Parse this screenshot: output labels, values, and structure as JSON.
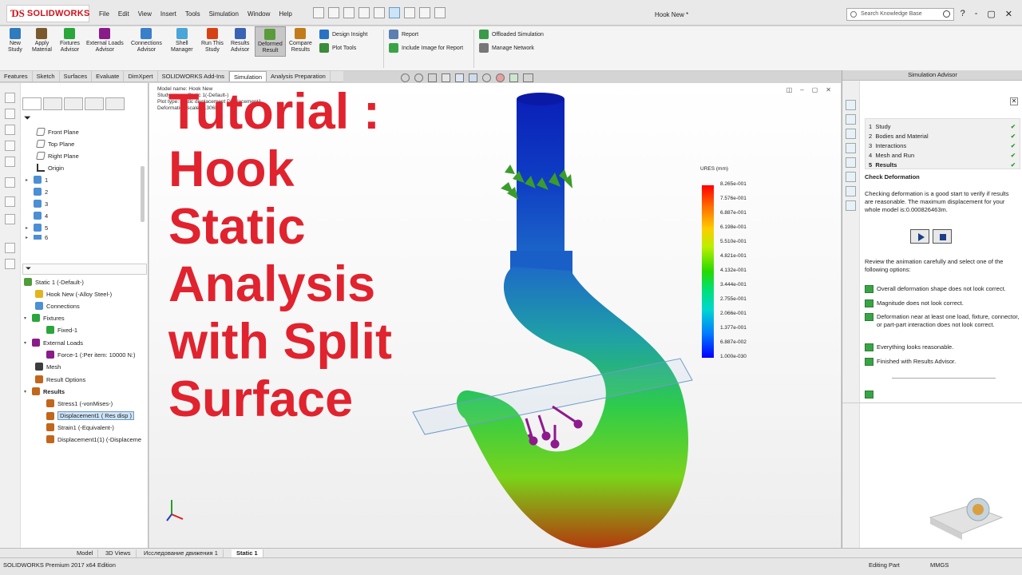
{
  "app": {
    "brand_ds": "ƊS",
    "brand_name": "SOLIDWORKS",
    "doc_title": "Hook New *",
    "search_placeholder": "Search Knowledge Base",
    "window_controls": [
      "?",
      "-",
      "▢",
      "✕"
    ]
  },
  "menu": [
    "File",
    "Edit",
    "View",
    "Insert",
    "Tools",
    "Simulation",
    "Window",
    "Help"
  ],
  "ribbon": {
    "buttons": [
      {
        "label1": "New",
        "label2": "Study",
        "color": "#2e7bbf"
      },
      {
        "label1": "Apply",
        "label2": "Material",
        "color": "#7a5a2c"
      },
      {
        "label1": "Fixtures",
        "label2": "Advisor",
        "color": "#2aa63b"
      },
      {
        "label1": "External Loads",
        "label2": "Advisor",
        "color": "#8a1c8a"
      },
      {
        "label1": "Connections",
        "label2": "Advisor",
        "color": "#3a7fc9"
      },
      {
        "label1": "Shell",
        "label2": "Manager",
        "color": "#4aa5d8"
      },
      {
        "label1": "Run This",
        "label2": "Study",
        "color": "#d64215"
      },
      {
        "label1": "Results",
        "label2": "Advisor",
        "color": "#3a63b5"
      },
      {
        "label1": "Deformed",
        "label2": "Result",
        "color": "#5a9c3a"
      },
      {
        "label1": "Compare",
        "label2": "Results",
        "color": "#c27b1b"
      }
    ],
    "small": [
      "Design Insight",
      "Plot Tools",
      "Report",
      "Include Image for Report",
      "Offloaded Simulation",
      "Manage Network"
    ]
  },
  "tabs": [
    "Features",
    "Sketch",
    "Surfaces",
    "Evaluate",
    "DimXpert",
    "SOLIDWORKS Add-Ins",
    "Simulation",
    "Analysis Preparation"
  ],
  "feature_tree": [
    "Front Plane",
    "Top Plane",
    "Right Plane",
    "Origin",
    "1",
    "2",
    "3",
    "4",
    "5",
    "6"
  ],
  "study_tree": {
    "study": "Static 1 (-Default-)",
    "part": "Hook New (-Alloy Steel-)",
    "connections": "Connections",
    "fixtures": "Fixtures",
    "fixed": "Fixed-1",
    "external_loads": "External Loads",
    "force": "Force-1 (:Per item: 10000 N:)",
    "mesh": "Mesh",
    "result_options": "Result Options",
    "results": "Results",
    "stress": "Stress1 (-vonMises-)",
    "displacement": "Displacement1 ( Res disp )",
    "strain": "Strain1 (-Equivalent-)",
    "displacement2": "Displacement1(1) (-Displaceme"
  },
  "viewport": {
    "info_lines": [
      "Model name: Hook New",
      "Study name: Static 1(-Default-)",
      "Plot type: Static displacement Displacement1",
      "Deformation scale: 8.3068"
    ],
    "overlay_lines": [
      "Tutorial :",
      "Hook",
      "Static",
      "Analysis",
      "with Split",
      "Surface"
    ],
    "legend_title": "URES (mm)",
    "legend_values": [
      "8.265e-001",
      "7.576e-001",
      "6.887e-001",
      "6.198e-001",
      "5.510e-001",
      "4.821e-001",
      "4.132e-001",
      "3.444e-001",
      "2.755e-001",
      "2.066e-001",
      "1.377e-001",
      "6.887e-002",
      "1.000e-030"
    ]
  },
  "advisor": {
    "header": "Simulation Advisor",
    "close": "✕",
    "steps": [
      {
        "num": "1",
        "label": "Study"
      },
      {
        "num": "2",
        "label": "Bodies and Material"
      },
      {
        "num": "3",
        "label": "Interactions"
      },
      {
        "num": "4",
        "label": "Mesh and Run"
      },
      {
        "num": "5",
        "label": "Results"
      }
    ],
    "check": "✔",
    "title": "Check Deformation",
    "body": "Checking deformation is a good start to verify if results are reasonable. The maximum displacement for your whole model is:0.000826463m.",
    "review": "Review the animation carefully and select one of the following options:",
    "options": [
      "Overall deformation shape does not look correct.",
      "Magnitude does not look correct.",
      "Deformation near at least one load, fixture, connector, or part-part interaction does not look correct.",
      "Everything looks reasonable.",
      "Finished with Results Advisor."
    ]
  },
  "bottom_tabs": [
    "Model",
    "3D Views",
    "Исследование движения 1",
    "Static 1"
  ],
  "status": {
    "left": "SOLIDWORKS Premium 2017 x64 Edition",
    "mode": "Editing Part",
    "units": "MMGS"
  },
  "colors": {
    "accent_red": "#e0232e",
    "brand_red": "#d0111b",
    "advisor_green": "#3aa346"
  }
}
